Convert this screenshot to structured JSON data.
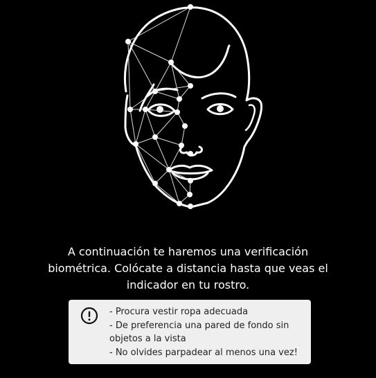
{
  "screen": {
    "background_color": "#000000"
  },
  "illustration": {
    "name": "face-biometric-mesh-icon",
    "stroke_color": "#ffffff"
  },
  "instruction": {
    "text": "A continuación te haremos una verificación biométrica. Colócate a distancia hasta que veas el indicador en tu rostro."
  },
  "tips": {
    "icon": "exclamation-circle-icon",
    "background_color": "#efefef",
    "items": [
      "- Procura vestir ropa adecuada",
      "- De preferencia una pared de fondo sin objetos a la vista",
      "- No olvides parpadear al menos una vez!"
    ]
  }
}
